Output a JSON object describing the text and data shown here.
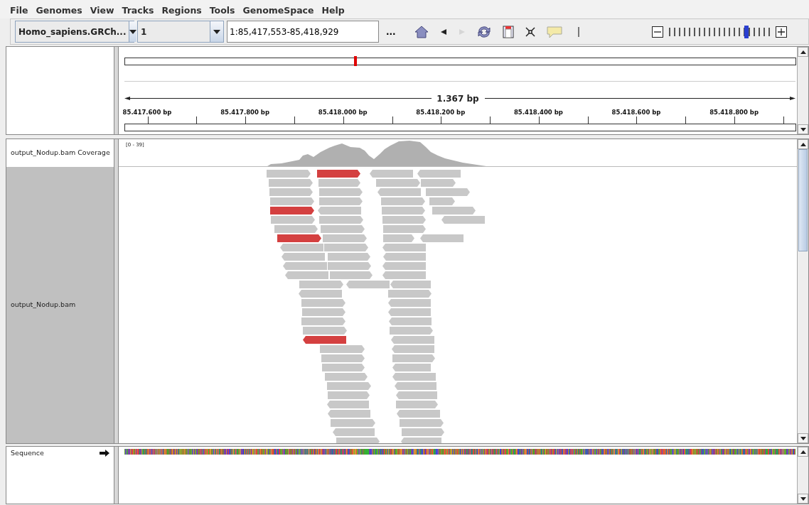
{
  "menu": [
    "File",
    "Genomes",
    "View",
    "Tracks",
    "Regions",
    "Tools",
    "GenomeSpace",
    "Help"
  ],
  "toolbar": {
    "genome": "Homo_sapiens.GRCh...",
    "chromosome": "1",
    "locus": "1:85,417,553-85,418,929",
    "more_button": "...",
    "tools": [
      {
        "kind": "home",
        "disabled": false
      },
      {
        "kind": "back",
        "disabled": false
      },
      {
        "kind": "forward",
        "disabled": true
      },
      {
        "kind": "refresh",
        "disabled": false
      },
      {
        "kind": "region",
        "disabled": false
      },
      {
        "kind": "fit",
        "disabled": false
      },
      {
        "kind": "popup",
        "disabled": false
      }
    ]
  },
  "zoom": {
    "level": 0.78
  },
  "ruler": {
    "span": "1.367 bp",
    "ticks": [
      "85.417.600 bp",
      "85.417.800 bp",
      "85.418.000 bp",
      "85.418.200 bp",
      "85.418.400 bp",
      "85.418.600 bp",
      "85.418.800 bp"
    ]
  },
  "tracks": [
    {
      "name": "output_Nodup.bam Coverage",
      "kind": "coverage",
      "range": "[0 - 39]",
      "selected": false
    },
    {
      "name": "output_Nodup.bam",
      "kind": "alignment",
      "selected": true
    }
  ],
  "sequence": {
    "name": "Sequence"
  }
}
